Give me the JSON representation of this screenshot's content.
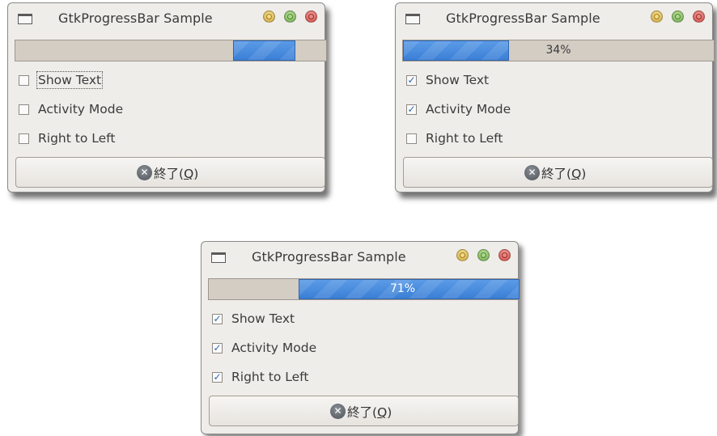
{
  "windows": [
    {
      "title": "GtkProgressBar Sample",
      "progress": {
        "fraction": 0.2,
        "start": 0.7,
        "text": ""
      },
      "checkboxes": [
        {
          "label": "Show Text",
          "checked": false
        },
        {
          "label": "Activity Mode",
          "checked": false
        },
        {
          "label": "Right to Left",
          "checked": false
        }
      ],
      "quit": {
        "prefix": "終了(",
        "mnemonic": "Q",
        "suffix": ")"
      }
    },
    {
      "title": "GtkProgressBar Sample",
      "progress": {
        "fraction": 0.34,
        "start": 0.0,
        "text": "34%"
      },
      "checkboxes": [
        {
          "label": "Show Text",
          "checked": true
        },
        {
          "label": "Activity Mode",
          "checked": true
        },
        {
          "label": "Right to Left",
          "checked": false
        }
      ],
      "quit": {
        "prefix": "終了(",
        "mnemonic": "Q",
        "suffix": ")"
      }
    },
    {
      "title": "GtkProgressBar Sample",
      "progress": {
        "fraction": 0.71,
        "start": 0.29,
        "text": "71%"
      },
      "checkboxes": [
        {
          "label": "Show Text",
          "checked": true
        },
        {
          "label": "Activity Mode",
          "checked": true
        },
        {
          "label": "Right to Left",
          "checked": true
        }
      ],
      "quit": {
        "prefix": "終了(",
        "mnemonic": "Q",
        "suffix": ")"
      }
    }
  ],
  "icons": {
    "window": "window-icon",
    "minimize": "minimize-icon",
    "maximize": "maximize-icon",
    "close": "close-icon",
    "quit": "quit-icon"
  },
  "colors": {
    "progress_fill": "#3b7fd6",
    "trough": "#d3cdc4",
    "window_bg": "#efedea"
  }
}
